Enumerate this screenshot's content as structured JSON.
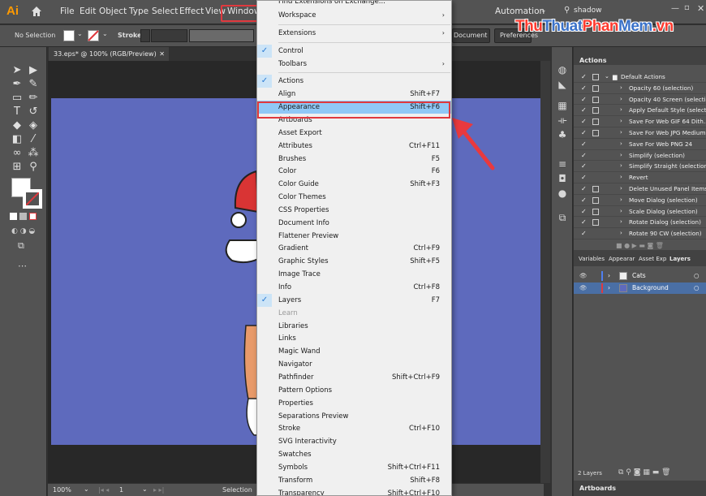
{
  "menubar": {
    "logo": "Ai",
    "items": [
      "File",
      "Edit",
      "Object",
      "Type",
      "Select",
      "Effect",
      "View",
      "Window"
    ],
    "workspace_label": "Automation",
    "search_value": "shadow"
  },
  "controlbar": {
    "selection_label": "No Selection",
    "stroke_label": "Stroke:",
    "doc_setup_label": "Document Setup",
    "preferences_label": "Preferences"
  },
  "document": {
    "tab_title": "33.eps* @ 100% (RGB/Preview)",
    "zoom": "100%",
    "page": "1",
    "status_tool": "Selection",
    "artboard_color": "#5e6abd"
  },
  "window_menu": {
    "top_cut": "Find Extensions on Exchange...",
    "items": [
      {
        "label": "Workspace",
        "submenu": true
      },
      {
        "sep": true
      },
      {
        "label": "Extensions",
        "submenu": true
      },
      {
        "sep": true
      },
      {
        "label": "Control",
        "checked": true
      },
      {
        "label": "Toolbars",
        "submenu": true
      },
      {
        "sep": true
      },
      {
        "label": "Actions",
        "checked": true
      },
      {
        "label": "Align",
        "shortcut": "Shift+F7"
      },
      {
        "label": "Appearance",
        "shortcut": "Shift+F6",
        "highlighted": true
      },
      {
        "label": "Artboards"
      },
      {
        "label": "Asset Export"
      },
      {
        "label": "Attributes",
        "shortcut": "Ctrl+F11"
      },
      {
        "label": "Brushes",
        "shortcut": "F5"
      },
      {
        "label": "Color",
        "shortcut": "F6"
      },
      {
        "label": "Color Guide",
        "shortcut": "Shift+F3"
      },
      {
        "label": "Color Themes"
      },
      {
        "label": "CSS Properties"
      },
      {
        "label": "Document Info"
      },
      {
        "label": "Flattener Preview"
      },
      {
        "label": "Gradient",
        "shortcut": "Ctrl+F9"
      },
      {
        "label": "Graphic Styles",
        "shortcut": "Shift+F5"
      },
      {
        "label": "Image Trace"
      },
      {
        "label": "Info",
        "shortcut": "Ctrl+F8"
      },
      {
        "label": "Layers",
        "shortcut": "F7",
        "checked": true
      },
      {
        "label": "Learn",
        "disabled": true
      },
      {
        "label": "Libraries"
      },
      {
        "label": "Links"
      },
      {
        "label": "Magic Wand"
      },
      {
        "label": "Navigator"
      },
      {
        "label": "Pathfinder",
        "shortcut": "Shift+Ctrl+F9"
      },
      {
        "label": "Pattern Options"
      },
      {
        "label": "Properties"
      },
      {
        "label": "Separations Preview"
      },
      {
        "label": "Stroke",
        "shortcut": "Ctrl+F10"
      },
      {
        "label": "SVG Interactivity"
      },
      {
        "label": "Swatches"
      },
      {
        "label": "Symbols",
        "shortcut": "Shift+Ctrl+F11"
      },
      {
        "label": "Transform",
        "shortcut": "Shift+F8"
      },
      {
        "label": "Transparency",
        "shortcut": "Shift+Ctrl+F10"
      }
    ]
  },
  "actions_panel": {
    "title": "Actions",
    "set_name": "Default Actions",
    "actions": [
      "Opacity 60 (selection)",
      "Opacity 40 Screen (selecti...",
      "Apply Default Style (select...",
      "Save For Web GIF 64 Dith...",
      "Save For Web JPG Medium",
      "Save For Web PNG 24",
      "Simplify (selection)",
      "Simplify Straight (selection)",
      "Revert",
      "Delete Unused Panel Items",
      "Move Dialog (selection)",
      "Scale Dialog (selection)",
      "Rotate Dialog (selection)",
      "Rotate 90 CW (selection)"
    ]
  },
  "layers_panel": {
    "tabs": [
      "Variables",
      "Appearar",
      "Asset Exp",
      "Layers"
    ],
    "layers": [
      {
        "name": "Cats",
        "color": "#4f7ff0"
      },
      {
        "name": "Background",
        "color": "#e0393e"
      }
    ],
    "count": "2 Layers",
    "artboards_label": "Artboards"
  },
  "watermark": {
    "part1": "Thu",
    "part2": "Thuat",
    "part3": "Phan",
    "part4": "Mem",
    "part5": ".vn"
  }
}
